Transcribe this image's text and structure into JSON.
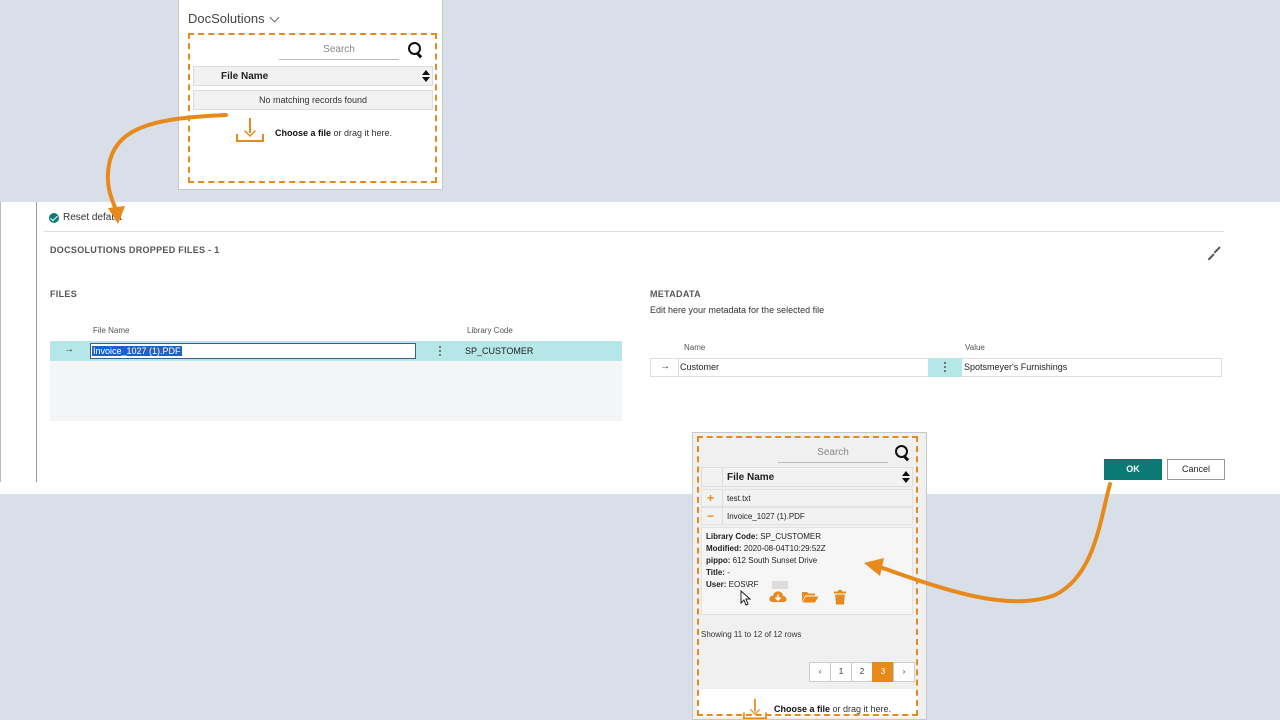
{
  "top_panel": {
    "title": "DocSolutions",
    "search_placeholder": "Search",
    "column_header": "File Name",
    "empty_message": "No matching records found",
    "drop_bold": "Choose a file",
    "drop_rest": " or drag it here."
  },
  "main": {
    "reset_label": "Reset default",
    "section_title": "DOCSOLUTIONS DROPPED FILES - 1",
    "files": {
      "caption": "FILES",
      "col_file_name": "File Name",
      "col_library_code": "Library Code",
      "rows": [
        {
          "file_name": "Invoice_1027 (1).PDF",
          "library_code": "SP_CUSTOMER"
        }
      ]
    },
    "metadata": {
      "caption": "METADATA",
      "subtitle": "Edit here your metadata for the selected file",
      "col_name": "Name",
      "col_value": "Value",
      "rows": [
        {
          "name": "Customer",
          "value": "Spotsmeyer's Furnishings"
        }
      ]
    },
    "ok_label": "OK",
    "cancel_label": "Cancel"
  },
  "bottom_panel": {
    "search_placeholder": "Search",
    "column_header": "File Name",
    "rows": [
      {
        "sign": "+",
        "file_name": "test.txt"
      },
      {
        "sign": "−",
        "file_name": "Invoice_1027 (1).PDF"
      }
    ],
    "details": {
      "library_code_label": "Library Code:",
      "library_code": " SP_CUSTOMER",
      "modified_label": "Modified:",
      "modified": " 2020-08-04T10:29:52Z",
      "pippo_label": "pippo:",
      "pippo": " 612 South Sunset Drive",
      "title_label": "Title:",
      "title": " -",
      "user_label": "User:",
      "user": " EOS\\RF"
    },
    "showing": "Showing 11 to 12 of 12 rows",
    "pager": [
      "‹",
      "1",
      "2",
      "3",
      "›"
    ],
    "pager_active": "3",
    "drop_bold": "Choose a file",
    "drop_rest": " or drag it here."
  },
  "colors": {
    "accent_orange": "#e8891b",
    "teal": "#0b7a75",
    "row_highlight": "#b5e6e8"
  },
  "icons": [
    "search-icon",
    "sort-icon",
    "download-tray-icon",
    "check-circle-icon",
    "collapse-icon",
    "arrow-right-icon",
    "more-vertical-icon",
    "cloud-download-icon",
    "folder-open-icon",
    "trash-icon",
    "mouse-pointer-icon"
  ]
}
